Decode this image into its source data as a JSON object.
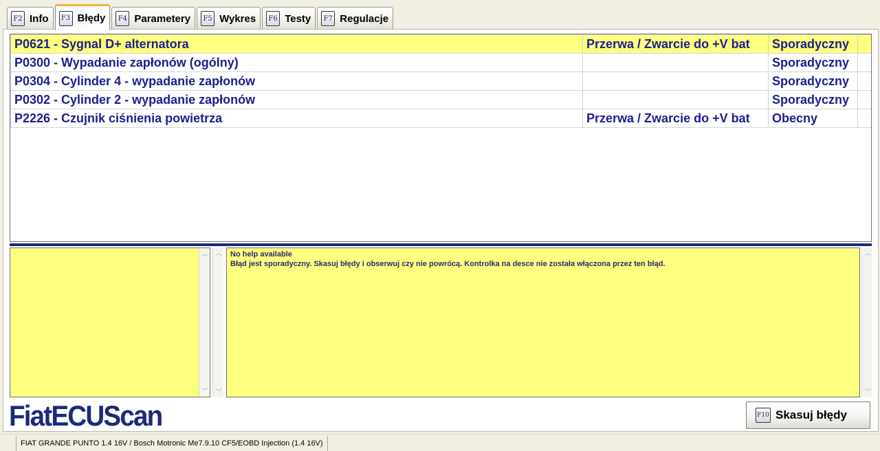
{
  "tabs": [
    {
      "key": "F2",
      "label": "Info"
    },
    {
      "key": "F3",
      "label": "Błędy"
    },
    {
      "key": "F4",
      "label": "Parametery"
    },
    {
      "key": "F5",
      "label": "Wykres"
    },
    {
      "key": "F6",
      "label": "Testy"
    },
    {
      "key": "F7",
      "label": "Regulacje"
    }
  ],
  "active_tab": "Błędy",
  "errors": [
    {
      "code": "P0621 - Sygnal D+ alternatora",
      "fault": "Przerwa / Zwarcie do +V bat",
      "status": "Sporadyczny",
      "selected": true
    },
    {
      "code": "P0300 - Wypadanie zapłonów (ogólny)",
      "fault": "",
      "status": "Sporadyczny",
      "selected": false
    },
    {
      "code": "P0304 - Cylinder 4 - wypadanie zapłonów",
      "fault": "",
      "status": "Sporadyczny",
      "selected": false
    },
    {
      "code": "P0302 - Cylinder 2 - wypadanie zapłonów",
      "fault": "",
      "status": "Sporadyczny",
      "selected": false
    },
    {
      "code": "P2226 - Czujnik ciśnienia powietrza",
      "fault": "Przerwa / Zwarcie do +V bat",
      "status": "Obecny",
      "selected": false
    }
  ],
  "help": {
    "title": "No help available",
    "text": "Błąd jest sporadyczny. Skasuj błędy i obserwuj czy nie powrócą. Kontrolka na desce nie została włączona przez ten błąd."
  },
  "logo": "FiatECUScan",
  "clear_button": {
    "key": "F10",
    "label": "Skasuj błędy"
  },
  "status_bar": "FIAT GRANDE PUNTO 1.4 16V / Bosch Motronic Me7.9.10 CF5/EOBD Injection (1.4 16V)",
  "colors": {
    "selected_row": "#ffff80",
    "text_blue": "#1c1f8c",
    "accent_tab": "#f0b43b",
    "divider": "#1b2a7a"
  }
}
